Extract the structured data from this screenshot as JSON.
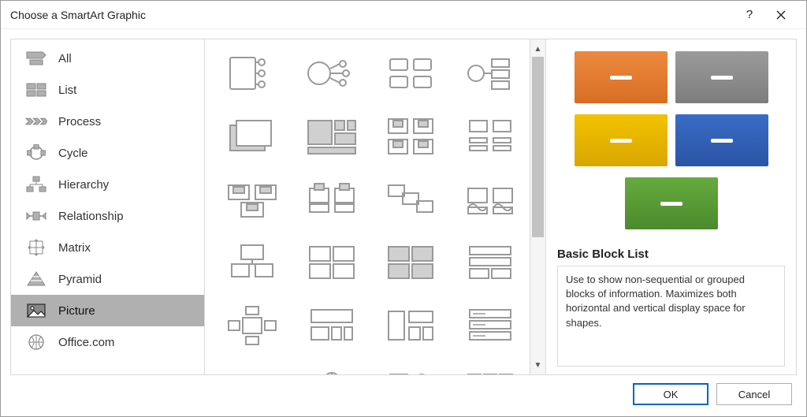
{
  "dialog": {
    "title": "Choose a SmartArt Graphic"
  },
  "sidebar": {
    "items": [
      {
        "label": "All"
      },
      {
        "label": "List"
      },
      {
        "label": "Process"
      },
      {
        "label": "Cycle"
      },
      {
        "label": "Hierarchy"
      },
      {
        "label": "Relationship"
      },
      {
        "label": "Matrix"
      },
      {
        "label": "Pyramid"
      },
      {
        "label": "Picture"
      },
      {
        "label": "Office.com"
      }
    ],
    "selected_index": 8
  },
  "preview": {
    "title": "Basic Block List",
    "description": "Use to show non-sequential or grouped blocks of information. Maximizes both horizontal and vertical display space for shapes.",
    "colors": {
      "block1": "#e07b2e",
      "block2": "#8e8e8e",
      "block3": "#e8b500",
      "block4": "#2f5eb3",
      "block5": "#569a33"
    }
  },
  "buttons": {
    "ok": "OK",
    "cancel": "Cancel"
  }
}
